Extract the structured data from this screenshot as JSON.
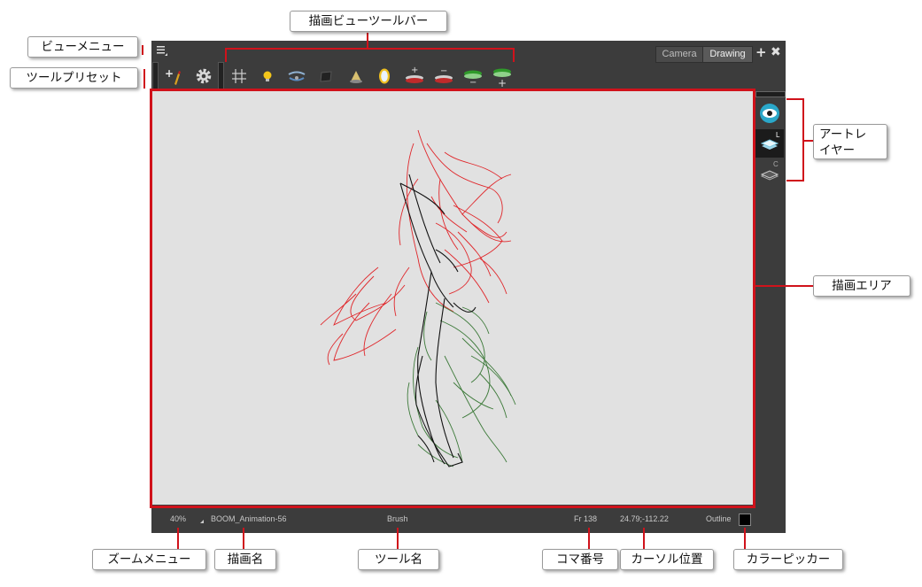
{
  "window": {
    "tabs": [
      {
        "label": "Camera",
        "active": false
      },
      {
        "label": "Drawing",
        "active": true
      }
    ],
    "add_tab_glyph": "+",
    "close_tab_glyph": "✖",
    "view_menu_icon": "hamburger-menu-icon"
  },
  "toolbar": {
    "tool_presets": [
      "add-preset-icon",
      "gear-icon"
    ],
    "drawing_view_tools": [
      "grid-icon",
      "light-table-icon",
      "onion-skin-icon",
      "underlay-layer-icon",
      "shade-icon",
      "mirror-icon",
      "add-onion-icon",
      "remove-onion-icon",
      "reduce-onion-icon",
      "add-color-onion-icon"
    ]
  },
  "art_layers": {
    "line_badge": "L",
    "color_badge": "C"
  },
  "status_bar": {
    "zoom": "40%",
    "drawing_name": "BOOM_Animation-56",
    "tool_name": "Brush",
    "frame": "Fr 138",
    "cursor_position": "24.79;-112.22",
    "view_mode": "Outline"
  },
  "callouts": {
    "view_menu": "ビューメニュー",
    "tool_presets": "ツールプリセット",
    "drawing_view_toolbar": "描画ビューツールバー",
    "art_layer_line1": "アートレ",
    "art_layer_line2": "イヤー",
    "drawing_area": "描画エリア",
    "zoom_menu": "ズームメニュー",
    "drawing_name": "描画名",
    "tool_name": "ツール名",
    "frame_number": "コマ番号",
    "cursor_position": "カーソル位置",
    "color_picker": "カラーピッカー"
  },
  "colors": {
    "callout_red": "#d0121b",
    "panel_bg": "#3c3c3c",
    "canvas_bg": "#e1e1e1",
    "sketch_red": "#e0262a",
    "sketch_green": "#3d7a3a",
    "sketch_black": "#111111"
  }
}
